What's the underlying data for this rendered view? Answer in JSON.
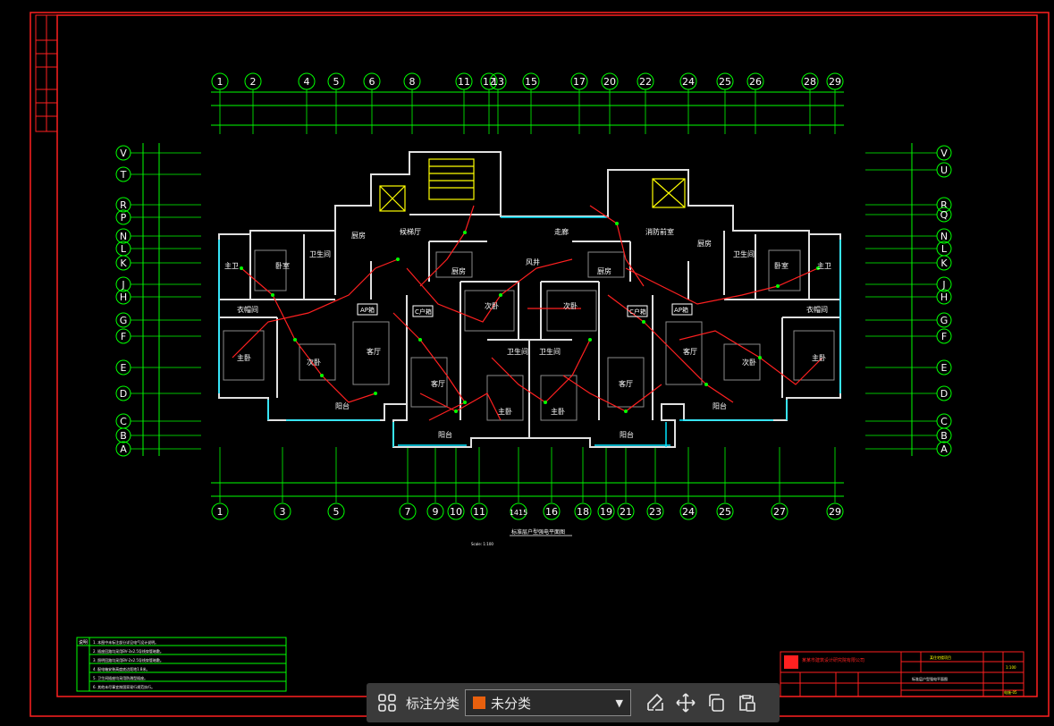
{
  "drawing": {
    "plan_title": "标准层户型强电平面图",
    "plan_scale": "Scale: 1:100",
    "top_axis_labels": [
      "1",
      "2",
      "4",
      "5",
      "6",
      "8",
      "11",
      "12",
      "13",
      "15",
      "17",
      "20",
      "22",
      "24",
      "25",
      "26",
      "28",
      "29"
    ],
    "bottom_axis_labels": [
      "1",
      "3",
      "5",
      "7",
      "9",
      "10",
      "11",
      "1415",
      "16",
      "18",
      "19",
      "21",
      "23",
      "24",
      "25",
      "27",
      "29"
    ],
    "left_axis_labels": [
      "V",
      "T",
      "R",
      "P",
      "N",
      "L",
      "K",
      "J",
      "H",
      "G",
      "F",
      "E",
      "D",
      "C",
      "B",
      "A"
    ],
    "right_axis_labels": [
      "V",
      "U",
      "R",
      "Q",
      "N",
      "L",
      "K",
      "J",
      "H",
      "G",
      "F",
      "E",
      "D",
      "C",
      "B",
      "A"
    ],
    "room_labels": [
      {
        "id": "l-zhuwei",
        "text": "主卫"
      },
      {
        "id": "l-woshi",
        "text": "卧室"
      },
      {
        "id": "l-weishengjian",
        "text": "卫生间"
      },
      {
        "id": "l-chufang-1",
        "text": "厨房"
      },
      {
        "id": "l-yimaojian",
        "text": "衣帽间"
      },
      {
        "id": "l-zhuwo-1",
        "text": "主卧"
      },
      {
        "id": "l-ciwo-1",
        "text": "次卧"
      },
      {
        "id": "l-keting-1",
        "text": "客厅"
      },
      {
        "id": "l-yangtai-1",
        "text": "阳台"
      },
      {
        "id": "l-houshi",
        "text": "候梯厅"
      },
      {
        "id": "l-zoulang",
        "text": "走廊"
      },
      {
        "id": "l-xiaofang",
        "text": "消防前室"
      },
      {
        "id": "l-dajing",
        "text": "风井"
      },
      {
        "id": "l-chufang-2",
        "text": "厨房"
      },
      {
        "id": "l-chufang-3",
        "text": "厨房"
      },
      {
        "id": "l-ciwo-2",
        "text": "次卧"
      },
      {
        "id": "l-ciwo-3",
        "text": "次卧"
      },
      {
        "id": "l-keting-2",
        "text": "客厅"
      },
      {
        "id": "l-keting-3",
        "text": "客厅"
      },
      {
        "id": "l-weisheng-2",
        "text": "卫生间"
      },
      {
        "id": "l-weisheng-3",
        "text": "卫生间"
      },
      {
        "id": "l-zhuwo-2",
        "text": "主卧"
      },
      {
        "id": "l-zhuwo-3",
        "text": "主卧"
      },
      {
        "id": "l-yangtai-2",
        "text": "阳台"
      },
      {
        "id": "l-yangtai-3",
        "text": "阳台"
      },
      {
        "id": "l-chufang-4",
        "text": "厨房"
      },
      {
        "id": "l-weisheng-4",
        "text": "卫生间"
      },
      {
        "id": "l-woshi-2",
        "text": "卧室"
      },
      {
        "id": "l-zhuwei-2",
        "text": "主卫"
      },
      {
        "id": "l-yimao-2",
        "text": "衣帽间"
      },
      {
        "id": "l-keting-4",
        "text": "客厅"
      },
      {
        "id": "l-ciwo-4",
        "text": "次卧"
      },
      {
        "id": "l-zhuwo-4",
        "text": "主卧"
      },
      {
        "id": "l-yangtai-4",
        "text": "阳台"
      }
    ],
    "panel_tags": [
      "AP箱",
      "C户箱",
      "C户箱",
      "AP箱"
    ],
    "notes_header": "说明",
    "notes_lines": [
      "1. 本图中未标注部分详见电气设计说明。",
      "2. 插座回路均采用BV-3x2.5导线穿管暗敷。",
      "3. 照明回路均采用BV-2x2.5导线穿管暗敷。",
      "4. 配电箱安装高度底边距地1.8米。",
      "5. 卫生间插座均采用防溅型插座。",
      "6. 其他未尽事宜按国家现行规范执行。"
    ],
    "title_block": {
      "company": "某某市建筑设计研究院有限公司",
      "project": "某住宅楼项目",
      "drawing_name": "标准层户型强电平面图",
      "scale": "1:100",
      "sheet": "电施-05"
    }
  },
  "toolbar": {
    "category_label": "标注分类",
    "selected_category": "未分类",
    "selected_color": "#e8600e"
  }
}
